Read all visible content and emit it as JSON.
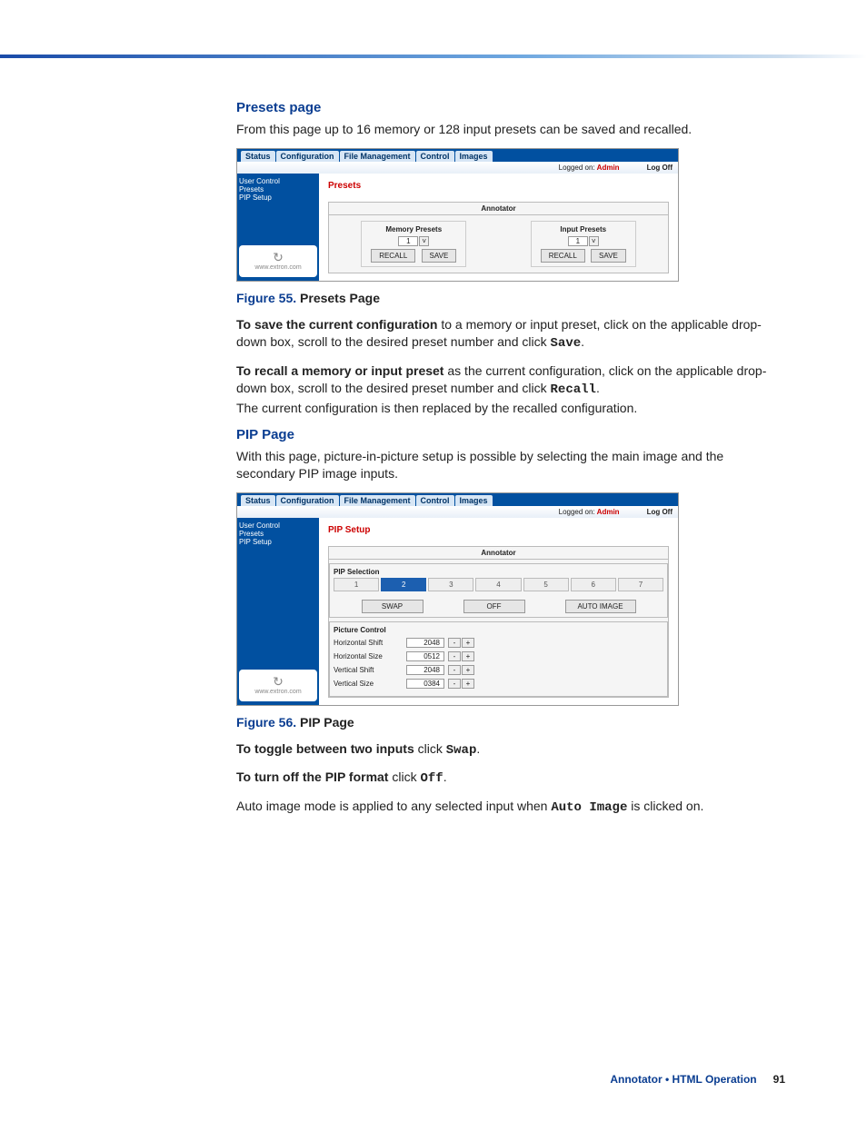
{
  "h1": "Presets page",
  "p1": "From this page up to 16 memory or 128 input presets can be saved and recalled.",
  "tabs": [
    "Status",
    "Configuration",
    "File Management",
    "Control",
    "Images"
  ],
  "logged": "Logged on:",
  "admin": "Admin",
  "logoff": "Log Off",
  "sidebar": [
    "User Control",
    "Presets",
    "PIP Setup"
  ],
  "extron": "www.extron.com",
  "f55": {
    "title": "Presets",
    "annot": "Annotator",
    "mem": "Memory Presets",
    "inp": "Input Presets",
    "num": "1",
    "recall": "RECALL",
    "save": "SAVE"
  },
  "cap55": {
    "n": "Figure 55.",
    "t": " Presets Page"
  },
  "p2a": "To save the current configuration",
  "p2b": " to a memory or input preset, click on the applicable drop-down box, scroll to the desired preset number and click ",
  "p2c": "Save",
  "p2d": ".",
  "p3a": "To recall a memory or input preset",
  "p3b": " as the current configuration, click on the applicable drop-down box, scroll to the desired preset number and click ",
  "p3c": "Recall",
  "p3d": ".",
  "p3e": "The current configuration is then replaced by the recalled configuration.",
  "h2": "PIP Page",
  "p4": "With this page, picture-in-picture setup is possible by selecting the main image and the secondary PIP image inputs.",
  "f56": {
    "title": "PIP Setup",
    "annot": "Annotator",
    "sel": "PIP Selection",
    "nums": [
      "1",
      "2",
      "3",
      "4",
      "5",
      "6",
      "7"
    ],
    "swap": "SWAP",
    "off": "OFF",
    "auto": "AUTO IMAGE",
    "pc": "Picture Control",
    "rows": [
      {
        "l": "Horizontal Shift",
        "v": "2048"
      },
      {
        "l": "Horizontal Size",
        "v": "0512"
      },
      {
        "l": "Vertical Shift",
        "v": "2048"
      },
      {
        "l": "Vertical Size",
        "v": "0384"
      }
    ]
  },
  "cap56": {
    "n": "Figure 56.",
    "t": " PIP Page"
  },
  "p5a": "To toggle between two inputs",
  "p5b": " click ",
  "p5c": "Swap",
  "p5d": ".",
  "p6a": "To turn off the PIP format",
  "p6b": " click ",
  "p6c": "Off",
  "p6d": ".",
  "p7a": "Auto image mode is applied to any selected input when ",
  "p7b": "Auto Image",
  "p7c": " is clicked on.",
  "footer": {
    "name": "Annotator • HTML Operation",
    "page": "91"
  }
}
